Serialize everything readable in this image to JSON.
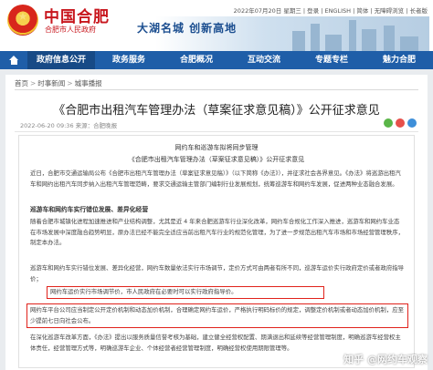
{
  "header": {
    "site_name": "中国合肥",
    "site_sub": "合肥市人民政府",
    "util_text": "2022年07月20日 星期三 | 登录 | ENGLISH | 简体 | 无障碍浏览 | 长者版",
    "slogan": "大湖名城  创新高地"
  },
  "nav": {
    "items": [
      "政府信息公开",
      "政务服务",
      "合肥概况",
      "互动交流",
      "专题专栏",
      "魅力合肥"
    ],
    "active_index": 0
  },
  "breadcrumb": {
    "items": [
      "首页",
      "时事新闻",
      "城事播报"
    ]
  },
  "article": {
    "title": "《合肥市出租汽车管理办法（草案征求意见稿）》公开征求意见",
    "meta": "2022-06-20 09:36  来源：合肥晚报"
  },
  "document": {
    "heading1": "网约车和巡游车拟将同步管理",
    "heading2": "《合肥市出租汽车管理办法（草案征求意见稿）》公开征求意见",
    "p1": "近日，合肥市交通运输局公布《合肥市出租汽车管理办法（草案征求意见稿）》（以下简称《办法》），并征求社会各界意见。《办法》将巡游出租汽车和网约出租汽车同步纳入出租汽车管理范畴，要求交通运输主管部门编制行业发展规划，统筹巡游车和网约车发展，促进两种业态融合发展。",
    "sect1": "巡游车和网约车实行错位发展、差异化经营",
    "p2": "随着合肥市城镇化进程加速推进和产业结构调整，尤其是近 4 年来合肥巡游车行业深化改革，网约车合规化工作深入推进，巡游车和网约车业态在市场发展中深度融合趋势明显，原办法已经不能完全适应当前出租汽车行业的规范化管理，为了进一步规范出租汽车市场和市场经营管理秩序，制定本办法。",
    "p3": "巡游车和网约车实行错位发展、差异化经营，网约车数量依法实行市场调节，定价方式可由两者有所不同，巡游车运价实行政府定价或者政府指导价；",
    "box1": "网约车运价实行市场调节价，市人民政府在必要时可以实行政府指导价。",
    "box2": "网约车平台公司应当制定公开定价机制和动态加价机制，合理确定网约车运价，严格执行明码标价的规定，调整定价机制或者动态加价机制，应至少提前七日向社会公布。",
    "p4": "在深化巡游车改革方面，《办法》提出以服务质量信誉考核为基础，建立健全经营权配置、期满退出和延续等经营管理制度，明确巡游车经营权主体责任，经营管理方式等，明确巡游车企业、个体经营者经营管理制度，明确经营权使用期限管理等。"
  },
  "watermark": "知乎 @网约车观察"
}
